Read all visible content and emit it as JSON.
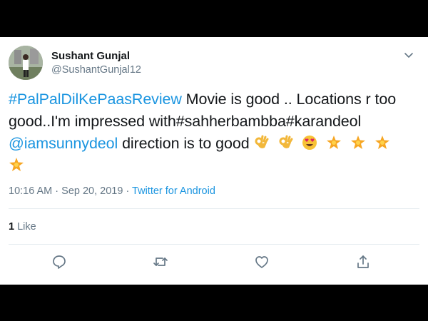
{
  "tweet": {
    "author_name": "Sushant Gunjal",
    "author_handle": "@SushantGunjal12",
    "text_line1_hashtag": "#PalPalDilKePaasReview",
    "text_line1_rest": " Movie is good .. Locations r too",
    "text_line2": "good..I'm impressed with#sahherbambba#karandeol",
    "text_line3_mention": "@iamsunnydeol",
    "text_line3_rest": " direction is to good",
    "emojis": [
      "ok-hand-icon",
      "ok-hand-icon",
      "heart-eyes-icon",
      "star-icon",
      "star-icon",
      "star-icon",
      "star-icon"
    ],
    "time": "10:16 AM · Sep 20, 2019 · ",
    "source": "Twitter for Android",
    "like_count": "1",
    "like_label": " Like"
  },
  "colors": {
    "link": "#1b95e0",
    "secondary_text": "#657786",
    "primary_text": "#14171a",
    "background_frame": "#000000"
  },
  "actions": [
    "reply-icon",
    "retweet-icon",
    "like-icon",
    "share-icon"
  ]
}
